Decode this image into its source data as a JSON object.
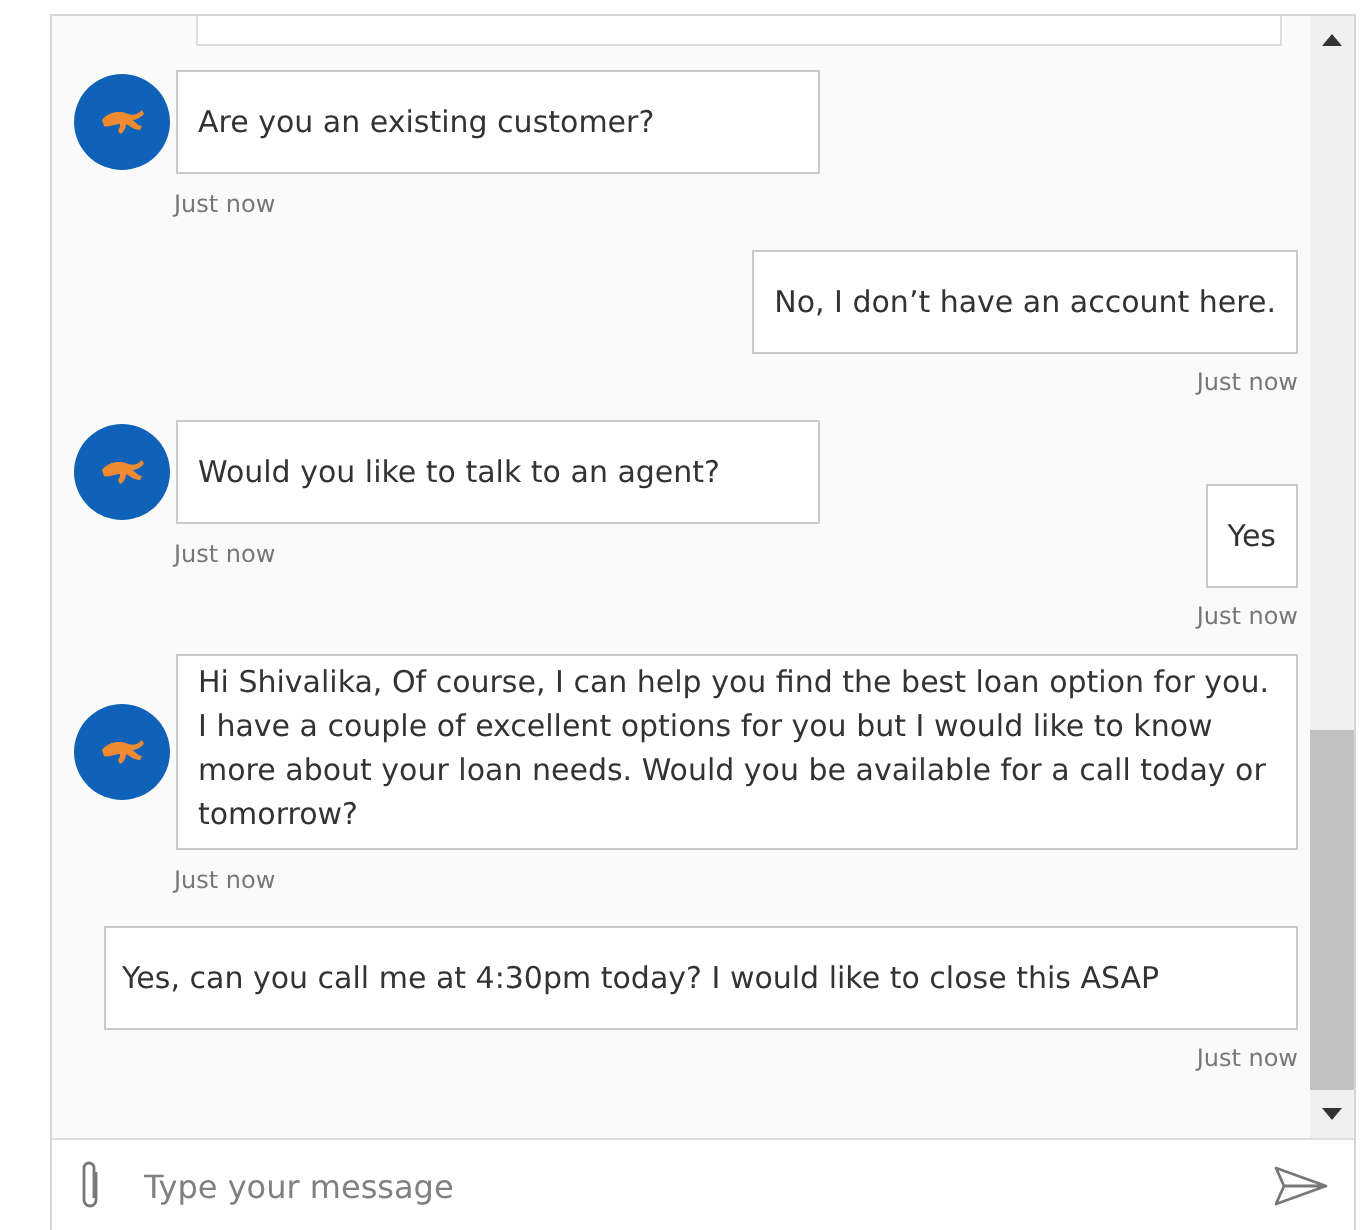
{
  "messages": [
    {
      "kind": "bot",
      "text": "Are you an existing customer?",
      "time": "Just now"
    },
    {
      "kind": "user",
      "text": "No, I don’t have an account here.",
      "time": "Just now"
    },
    {
      "kind": "bot",
      "text": "Would you like to talk to an agent?",
      "time": "Just now"
    },
    {
      "kind": "user",
      "text": "Yes",
      "time": "Just now"
    },
    {
      "kind": "bot",
      "text": "Hi Shivalika, Of course, I can help you find the best loan option for you. I have a couple of excellent options for you but I would like to know more about your loan needs. Would you be available for a call today or tomorrow?",
      "time": "Just now"
    },
    {
      "kind": "user",
      "text": "Yes, can you call me at 4:30pm today? I would like to close this ASAP",
      "time": "Just now"
    }
  ],
  "composer": {
    "placeholder": "Type your message"
  }
}
